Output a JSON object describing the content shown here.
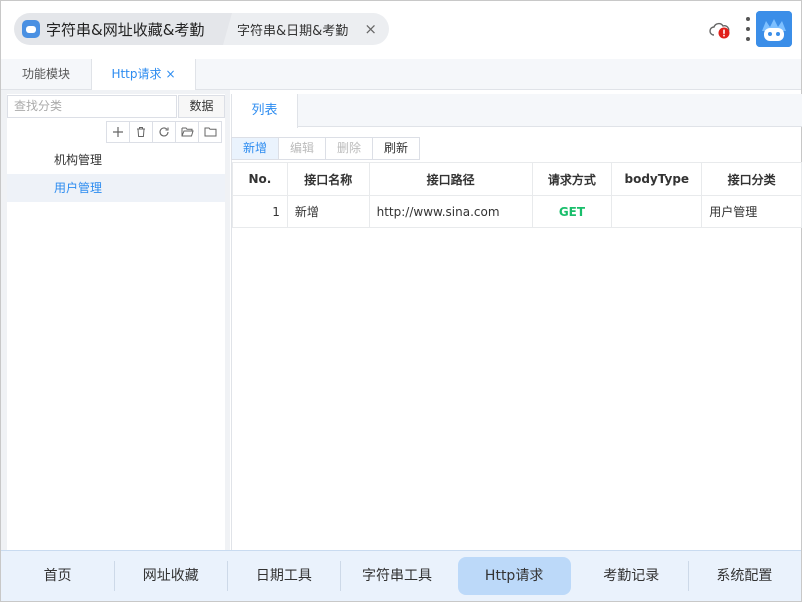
{
  "window": {
    "tabs": [
      {
        "label": "字符串&网址收藏&考勤"
      },
      {
        "label": "字符串&日期&考勤"
      }
    ],
    "close_glyph": "×",
    "status_icon": "cloud-alert-icon",
    "status_color": "#e0201a"
  },
  "subtabs": [
    {
      "label": "功能模块"
    },
    {
      "label": "Http请求",
      "close": "×"
    }
  ],
  "left_panel": {
    "search_placeholder": "查找分类",
    "data_button": "数据",
    "tree_items": [
      {
        "label": "机构管理"
      },
      {
        "label": "用户管理"
      }
    ]
  },
  "right_panel": {
    "tab": "列表",
    "actions": [
      {
        "label": "新增"
      },
      {
        "label": "编辑"
      },
      {
        "label": "删除"
      },
      {
        "label": "刷新"
      }
    ],
    "table": {
      "columns": [
        "No.",
        "接口名称",
        "接口路径",
        "请求方式",
        "bodyType",
        "接口分类"
      ],
      "rows": [
        [
          "1",
          "新增",
          "http://www.sina.com",
          "GET",
          "",
          "用户管理"
        ]
      ]
    }
  },
  "bottom_nav": [
    {
      "label": "首页"
    },
    {
      "label": "网址收藏"
    },
    {
      "label": "日期工具"
    },
    {
      "label": "字符串工具"
    },
    {
      "label": "Http请求"
    },
    {
      "label": "考勤记录"
    },
    {
      "label": "系统配置"
    }
  ],
  "colors": {
    "accent": "#2d8cf0",
    "method_get": "#19be6b",
    "nav_active": "#bcd9f9"
  }
}
